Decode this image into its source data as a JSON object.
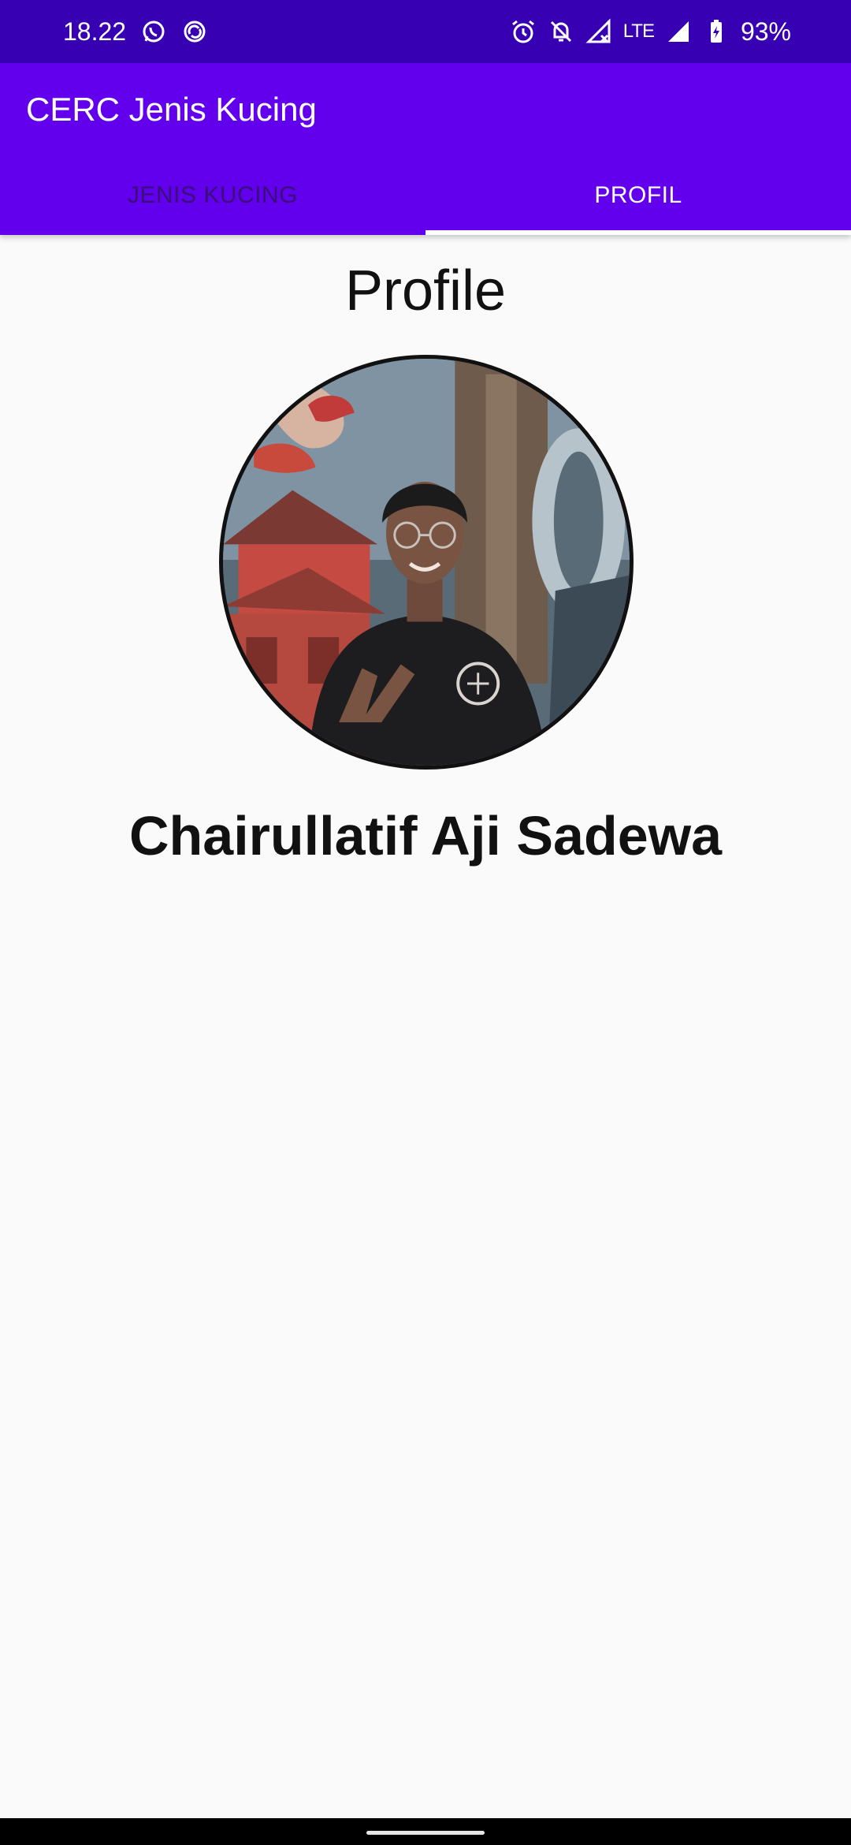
{
  "status_bar": {
    "time": "18.22",
    "network": "LTE",
    "battery": "93%",
    "icons_left": [
      "whatsapp-icon",
      "sync-icon"
    ],
    "icons_right": [
      "alarm-icon",
      "mute-icon",
      "signal-lte-icon",
      "signal-icon",
      "battery-icon"
    ]
  },
  "app_bar": {
    "title": "CERC Jenis Kucing"
  },
  "tabs": [
    {
      "label": "JENIS KUCING",
      "active": false
    },
    {
      "label": "PROFIL",
      "active": true
    }
  ],
  "profile": {
    "title": "Profile",
    "name": "Chairullatif Aji Sadewa"
  },
  "colors": {
    "status_bar": "#3700b3",
    "primary": "#6200ee",
    "background": "#fafafa"
  }
}
